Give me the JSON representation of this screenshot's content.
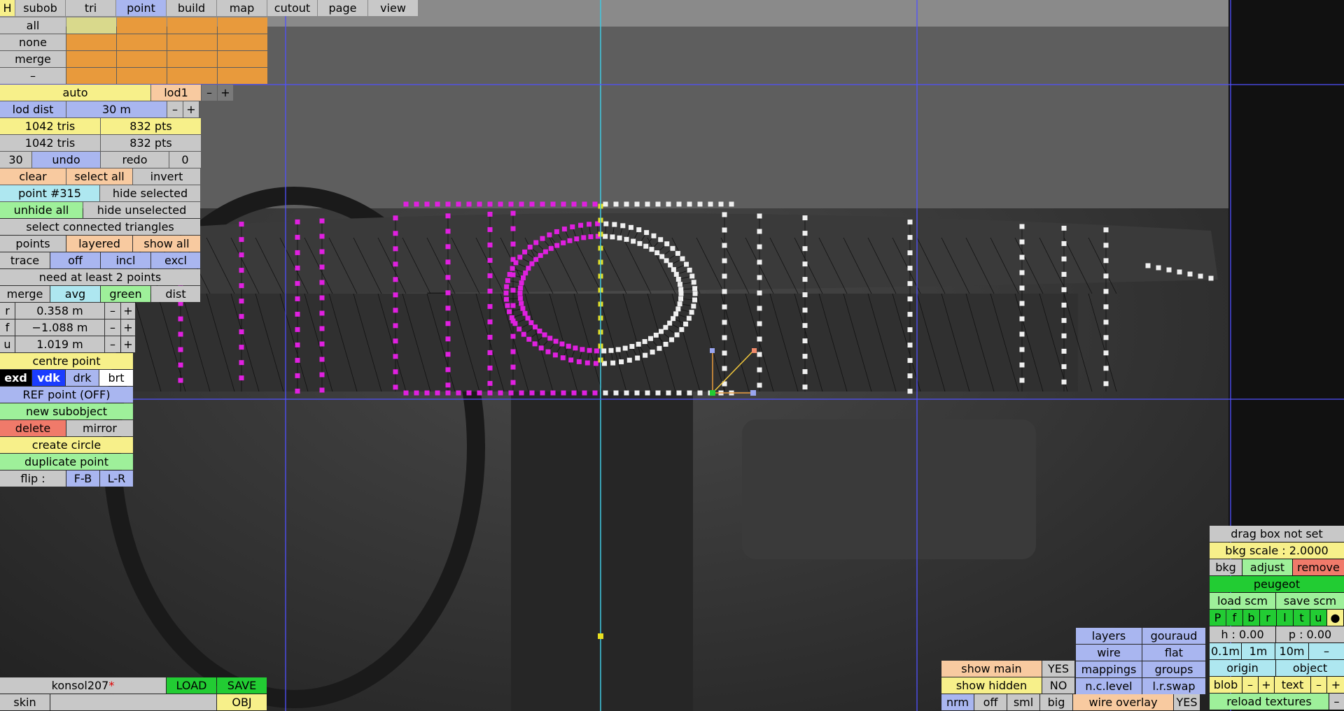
{
  "tabs": [
    "H",
    "subob",
    "tri",
    "point",
    "build",
    "map",
    "cutout",
    "page",
    "view"
  ],
  "active_tab": "point",
  "select_rows": [
    "all",
    "none",
    "merge",
    "–"
  ],
  "lod": {
    "auto": "auto",
    "name": "lod1",
    "minus": "–",
    "plus": "+"
  },
  "lod_dist": {
    "label": "lod dist",
    "value": "30 m",
    "minus": "–",
    "plus": "+"
  },
  "counts": [
    {
      "tris": "1042 tris",
      "pts": "832 pts"
    },
    {
      "tris": "1042 tris",
      "pts": "832 pts"
    }
  ],
  "undo_row": {
    "n": "30",
    "undo": "undo",
    "redo": "redo",
    "r": "0"
  },
  "select_row": {
    "clear": "clear",
    "select_all": "select all",
    "invert": "invert"
  },
  "point_row": {
    "point": "point #315",
    "hide_selected": "hide selected"
  },
  "unhide_row": {
    "unhide": "unhide all",
    "hide_unselected": "hide unselected"
  },
  "select_connected": "select connected triangles",
  "points_row": {
    "points": "points",
    "layered": "layered",
    "show_all": "show all"
  },
  "trace_row": {
    "trace": "trace",
    "off": "off",
    "incl": "incl",
    "excl": "excl"
  },
  "need_points": "need at least 2 points",
  "merge_row": {
    "merge": "merge",
    "avg": "avg",
    "green": "green",
    "dist": "dist"
  },
  "coords": [
    {
      "axis": "r",
      "value": "0.358 m",
      "minus": "–",
      "plus": "+"
    },
    {
      "axis": "f",
      "value": "−1.088 m",
      "minus": "–",
      "plus": "+"
    },
    {
      "axis": "u",
      "value": "1.019 m",
      "minus": "–",
      "plus": "+"
    }
  ],
  "centre_point": "centre point",
  "view_modes": [
    "exd",
    "vdk",
    "drk",
    "brt"
  ],
  "ref_point": "REF point (OFF)",
  "new_subobject": "new subobject",
  "delete_row": {
    "delete": "delete",
    "mirror": "mirror"
  },
  "create_circle": "create circle",
  "duplicate_point": "duplicate point",
  "flip_row": {
    "label": "flip :",
    "fb": "F-B",
    "lr": "L-R"
  },
  "file": {
    "name": "konsol207",
    "mark": "*",
    "load": "LOAD",
    "save": "SAVE",
    "skin": "skin",
    "obj": "OBJ"
  },
  "bottom_mid": {
    "show_main": "show main",
    "show_main_val": "YES",
    "show_hidden": "show hidden",
    "show_hidden_val": "NO",
    "nrm": "nrm",
    "off": "off",
    "sml": "sml",
    "big": "big",
    "layers": "layers",
    "gouraud": "gouraud",
    "wire": "wire",
    "flat": "flat",
    "mappings": "mappings",
    "groups": "groups",
    "nclevel": "n.c.level",
    "lrswap": "l.r.swap",
    "wire_overlay": "wire overlay",
    "wire_overlay_val": "YES"
  },
  "bottom_right": {
    "drag_box": "drag box not set",
    "bkg_scale": "bkg scale : 2.0000",
    "bkg": "bkg",
    "adjust": "adjust",
    "remove": "remove",
    "bkg_name": "peugeot",
    "load_scm": "load scm",
    "save_scm": "save scm",
    "views": [
      "P",
      "f",
      "b",
      "r",
      "l",
      "t",
      "u",
      "●"
    ],
    "h": "h : 0.00",
    "p": "p : 0.00",
    "steps": [
      "0.1m",
      "1m",
      "10m",
      "–"
    ],
    "origin": "origin",
    "object": "object",
    "blob": "blob",
    "minus": "–",
    "plus": "+",
    "text": "text",
    "reload": "reload textures",
    "reload_minus": "–"
  },
  "colors": {
    "selected_points": "#e020e0",
    "unselected_points": "#f0f0f0",
    "axis": "#40c8e0",
    "guides": "#5050ff"
  }
}
